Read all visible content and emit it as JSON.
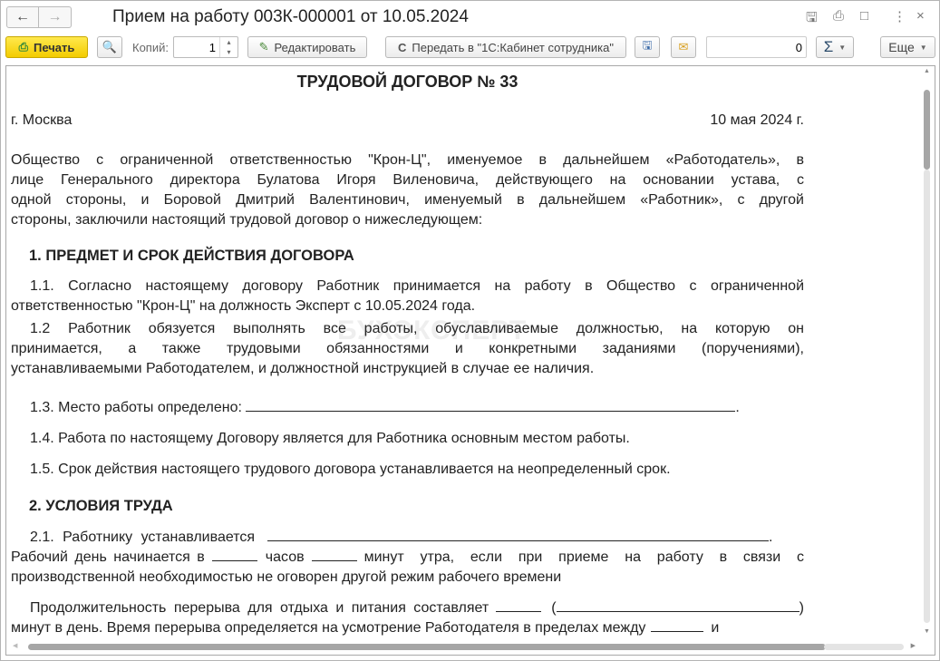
{
  "window": {
    "title": "Прием на работу 003К-000001 от 10.05.2024"
  },
  "toolbar": {
    "print": "Печать",
    "copies_label": "Копий:",
    "copies_value": "1",
    "edit": "Редактировать",
    "send": "Передать в \"1С:Кабинет сотрудника\"",
    "sum_value": "0",
    "sum_symbol": "Σ",
    "more": "Еще"
  },
  "doc": {
    "watermark": "БУХЭКСПЕРТ",
    "title": "ТРУДОВОЙ ДОГОВОР № 33",
    "city": "г. Москва",
    "date": "10 мая 2024 г.",
    "p1": [
      "Общество с ограниченной ответственностью \"Крон-Ц\", именуемое в дальнейшем «Работодатель», в",
      "лице Генерального директора Булатова Игоря Виленовича, действующего на основании устава, с",
      "одной стороны, и Боровой Дмитрий Валентинович, именуемый в дальнейшем «Работник», с другой",
      "стороны, заключили настоящий трудовой договор о нижеследующем:"
    ],
    "h1": "1. ПРЕДМЕТ И СРОК ДЕЙСТВИЯ ДОГОВОРА",
    "p11": [
      "1.1. Согласно настоящему договору Работник принимается на работу в Общество с ограниченной",
      "ответственностью \"Крон-Ц\" на должность Эксперт с 10.05.2024 года."
    ],
    "p12": [
      "1.2 Работник обязуется выполнять все работы, обуславливаемые должностью, на которую он",
      "принимается, а также трудовыми обязанностями и конкретными заданиями (поручениями),",
      "устанавливаемыми Работодателем, и должностной инструкцией в случае ее наличия."
    ],
    "p13": "1.3. Место работы определено:",
    "p14": "1.4. Работа по настоящему Договору является для Работника основным местом работы.",
    "p15": "1.5. Срок действия настоящего трудового договора устанавливается на неопределенный срок.",
    "h2": "2. УСЛОВИЯ ТРУДА",
    "p21a": "2.1. Работнику устанавливается",
    "p21b1": "Рабочий день начинается в",
    "p21b2": "часов",
    "p21b3": "минут утра, если при приеме на работу в связи с",
    "p21c": "производственной необходимостью не оговорен другой режим рабочего времени",
    "p22a": "Продолжительность перерыва для отдыха и питания составляет",
    "p22b": "минут в день. Время перерыва определяется на усмотрение Работодателя в пределах между",
    "p22b_end": "и",
    "dot": ".",
    "paren_open": "(",
    "paren_close": ")"
  }
}
